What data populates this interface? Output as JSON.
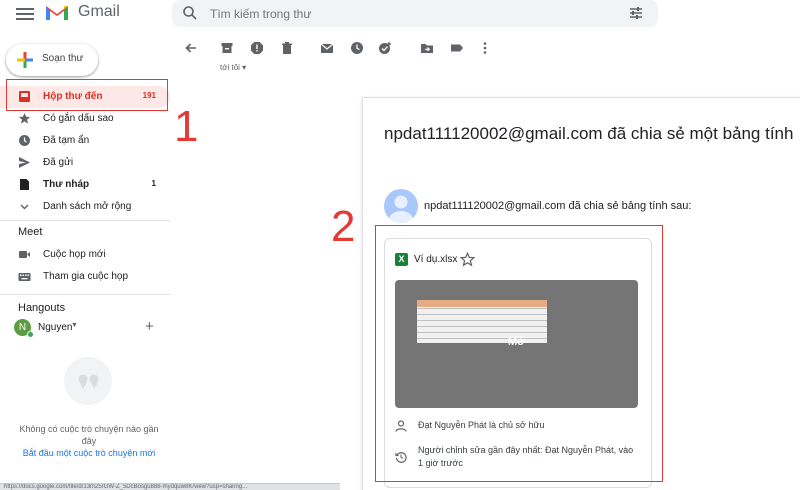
{
  "app": {
    "name": "Gmail"
  },
  "search": {
    "placeholder": "Tìm kiếm trong thư"
  },
  "compose": {
    "label": "Soạn thư"
  },
  "sidebar": {
    "items": [
      {
        "label": "Hộp thư đến",
        "count": "191",
        "icon": "inbox-icon"
      },
      {
        "label": "Có gắn dấu sao",
        "count": "",
        "icon": "star-icon"
      },
      {
        "label": "Đã tạm ẩn",
        "count": "",
        "icon": "clock-icon"
      },
      {
        "label": "Đã gửi",
        "count": "",
        "icon": "send-icon"
      },
      {
        "label": "Thư nháp",
        "count": "1",
        "icon": "draft-icon"
      },
      {
        "label": "Danh sách mở rộng",
        "count": "",
        "icon": "chevron-down-icon"
      }
    ]
  },
  "meet": {
    "title": "Meet",
    "items": [
      {
        "label": "Cuộc họp mới",
        "icon": "video-icon"
      },
      {
        "label": "Tham gia cuộc họp",
        "icon": "keyboard-icon"
      }
    ]
  },
  "hangouts": {
    "title": "Hangouts",
    "user_initial": "N",
    "user_name": "Nguyen",
    "empty_text": "Không có cuộc trò chuyện nào gần đây",
    "start_link": "Bắt đầu một cuộc trò chuyện mới"
  },
  "thread": {
    "to_line": "tới tôi",
    "subject": "npdat111120002@gmail.com đã chia sẻ một bảng tính",
    "sender_line": "npdat111120002@gmail.com đã chia sẻ bảng tính sau:"
  },
  "attachment": {
    "file_name": "Ví dụ.xlsx",
    "file_badge": "X",
    "open_label": "Mở",
    "owner_text": "Đạt Nguyễn Phát là chủ sở hữu",
    "edit_text": "Người chỉnh sửa gần đây nhất: Đạt Nguyễn Phát, vào 1 giờ trước"
  },
  "annotations": {
    "step1": "1",
    "step2": "2",
    "color": "#e53935"
  },
  "status_url": "https://docs.google.com/file/d/13m25rGW-Z_5DcBosgu888-mydquw8K/view?usp=sharing..."
}
